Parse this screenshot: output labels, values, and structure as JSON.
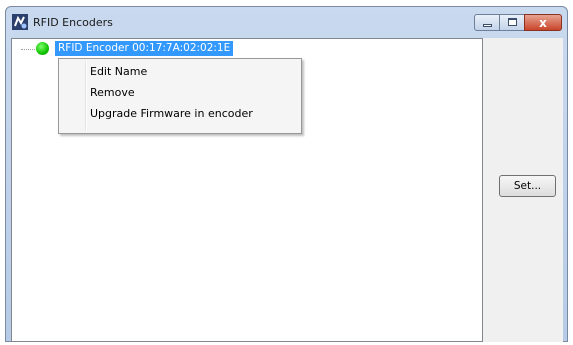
{
  "window": {
    "title": "RFID Encoders",
    "icon": "rfid-app-icon",
    "close_glyph": "x"
  },
  "tree": {
    "nodes": [
      {
        "label": "RFID Encoder 00:17:7A:02:02:1E",
        "status": "connected",
        "status_color": "#10c400",
        "selected": true
      }
    ]
  },
  "context_menu": {
    "items": [
      {
        "label": "Edit Name"
      },
      {
        "label": "Remove"
      },
      {
        "label": "Upgrade Firmware in encoder"
      }
    ]
  },
  "buttons": {
    "set_label": "Set..."
  },
  "colors": {
    "selection": "#3399ff",
    "client_background": "#f0f0f0"
  }
}
